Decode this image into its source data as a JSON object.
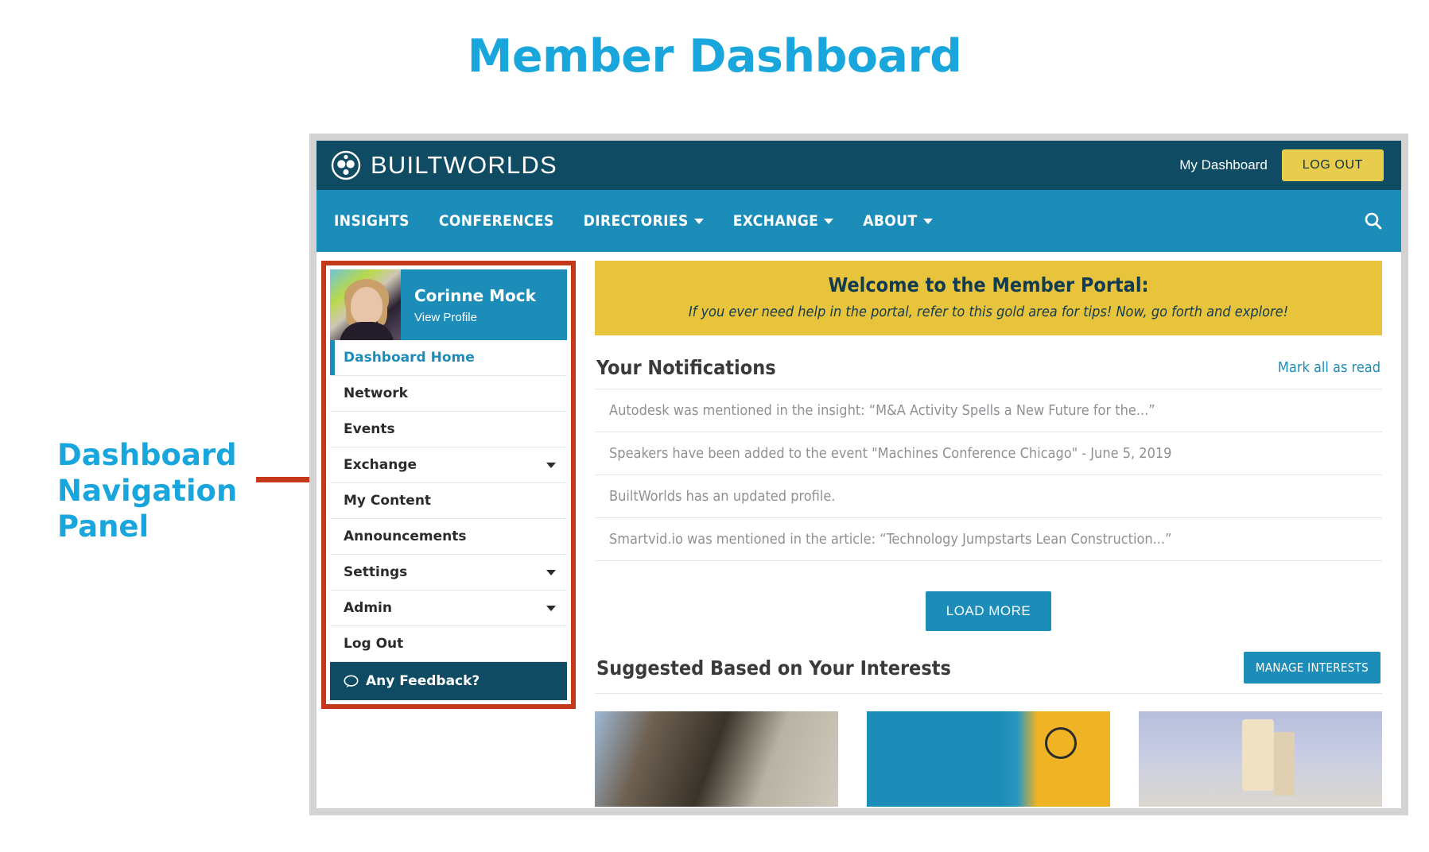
{
  "slide": {
    "title": "Member Dashboard",
    "annotation": "Dashboard Navigation Panel",
    "accent_blue": "#18a6dc",
    "callout_red": "#c4391a"
  },
  "topbar": {
    "brand": "BUILTWORLDS",
    "logo_icon": "builtworlds-logo-icon",
    "my_dashboard": "My Dashboard",
    "logout": "LOG OUT",
    "bg": "#0f4c63",
    "logout_bg": "#e8cc4d"
  },
  "navbar": {
    "bg": "#1c8cb8",
    "search_icon": "search-icon",
    "items": [
      {
        "label": "INSIGHTS",
        "has_caret": false
      },
      {
        "label": "CONFERENCES",
        "has_caret": false
      },
      {
        "label": "DIRECTORIES",
        "has_caret": true
      },
      {
        "label": "EXCHANGE",
        "has_caret": true
      },
      {
        "label": "ABOUT",
        "has_caret": true
      }
    ]
  },
  "sidebar": {
    "profile": {
      "name": "Corinne Mock",
      "view_profile": "View Profile",
      "avatar_icon": "avatar"
    },
    "items": [
      {
        "label": "Dashboard Home",
        "active": true,
        "has_caret": false
      },
      {
        "label": "Network",
        "active": false,
        "has_caret": false
      },
      {
        "label": "Events",
        "active": false,
        "has_caret": false
      },
      {
        "label": "Exchange",
        "active": false,
        "has_caret": true
      },
      {
        "label": "My Content",
        "active": false,
        "has_caret": false
      },
      {
        "label": "Announcements",
        "active": false,
        "has_caret": false
      },
      {
        "label": "Settings",
        "active": false,
        "has_caret": true
      },
      {
        "label": "Admin",
        "active": false,
        "has_caret": true
      },
      {
        "label": "Log Out",
        "active": false,
        "has_caret": false
      }
    ],
    "feedback": {
      "label": "Any Feedback?",
      "icon": "speech-bubble-icon"
    }
  },
  "welcome": {
    "title": "Welcome to the Member Portal:",
    "subtitle": "If you ever need help in the portal, refer to this gold area for tips! Now, go forth and explore!",
    "bg": "#e8c33c"
  },
  "notifications": {
    "title": "Your Notifications",
    "mark_all": "Mark all as read",
    "items": [
      "Autodesk was mentioned in the insight: “M&A Activity Spells a New Future for the...”",
      "Speakers have been added to the event \"Machines Conference Chicago\" - June 5, 2019",
      "BuiltWorlds has an updated profile.",
      "Smartvid.io was mentioned in the article: “Technology Jumpstarts Lean Construction...”"
    ],
    "load_more": "LOAD MORE"
  },
  "suggested": {
    "title": "Suggested Based on Your Interests",
    "manage": "MANAGE INTERESTS",
    "cards": [
      {
        "name": "suggested-card-1"
      },
      {
        "name": "suggested-card-2"
      },
      {
        "name": "suggested-card-3"
      }
    ]
  }
}
